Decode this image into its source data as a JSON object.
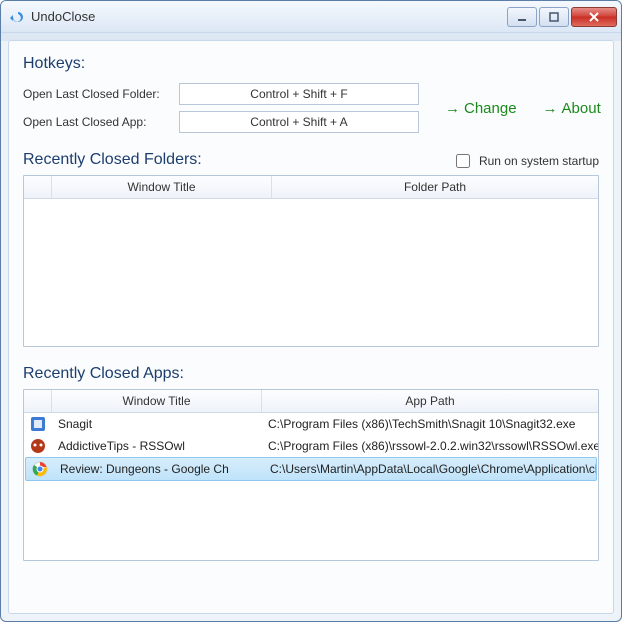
{
  "window": {
    "title": "UndoClose"
  },
  "hotkeys": {
    "heading": "Hotkeys:",
    "folder_label": "Open Last Closed Folder:",
    "folder_value": "Control + Shift + F",
    "app_label": "Open Last Closed App:",
    "app_value": "Control + Shift + A"
  },
  "links": {
    "change": "Change",
    "about": "About"
  },
  "folders": {
    "heading": "Recently Closed Folders:",
    "col_title": "Window Title",
    "col_path": "Folder Path",
    "rows": []
  },
  "startup": {
    "label": "Run on system startup",
    "checked": false
  },
  "apps": {
    "heading": "Recently Closed Apps:",
    "col_title": "Window Title",
    "col_path": "App Path",
    "rows": [
      {
        "icon": "snagit-icon",
        "title": "Snagit",
        "path": "C:\\Program Files (x86)\\TechSmith\\Snagit 10\\Snagit32.exe",
        "selected": false
      },
      {
        "icon": "rssowl-icon",
        "title": "AddictiveTips - RSSOwl",
        "path": "C:\\Program Files (x86)\\rssowl-2.0.2.win32\\rssowl\\RSSOwl.exe",
        "selected": false
      },
      {
        "icon": "chrome-icon",
        "title": "Review: Dungeons - Google Ch",
        "path": "C:\\Users\\Martin\\AppData\\Local\\Google\\Chrome\\Application\\ch",
        "selected": true
      }
    ]
  }
}
